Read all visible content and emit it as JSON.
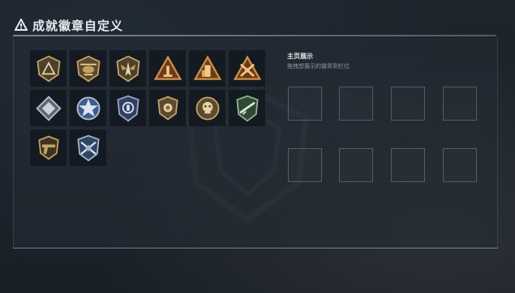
{
  "page": {
    "title": "成就徽章自定义",
    "title_icon": "triangle-warning-icon"
  },
  "display": {
    "title": "主页展示",
    "subtitle": "拖拽想展示的徽章到栏位",
    "slot_count": 8
  },
  "badges": [
    {
      "name": "gold-triangle-shield-badge",
      "icon": "triangle-emblem"
    },
    {
      "name": "helicopter-badge",
      "icon": "helicopter"
    },
    {
      "name": "wings-badge",
      "icon": "wings"
    },
    {
      "name": "triangle-pillar-badge",
      "icon": "pillar"
    },
    {
      "name": "triangle-tower-badge",
      "icon": "tower"
    },
    {
      "name": "triangle-crossed-arms-badge",
      "icon": "crossed-arms"
    },
    {
      "name": "silver-diamond-badge",
      "icon": "diamond"
    },
    {
      "name": "silver-star-badge",
      "icon": "star"
    },
    {
      "name": "blue-police-shield-badge",
      "icon": "police-shield"
    },
    {
      "name": "lion-shield-badge",
      "icon": "lion"
    },
    {
      "name": "skull-emblem-badge",
      "icon": "skull"
    },
    {
      "name": "green-rifle-badge",
      "icon": "rifle"
    },
    {
      "name": "gold-pistol-badge",
      "icon": "pistol"
    },
    {
      "name": "blue-crossed-rifles-badge",
      "icon": "crossed-rifles"
    }
  ],
  "colors": {
    "gold": "#c9a25a",
    "dark_gold": "#6b5430",
    "silver": "#b7c2cf",
    "blue": "#3e5b94",
    "green": "#4e7a52",
    "orange": "#d0923c"
  }
}
